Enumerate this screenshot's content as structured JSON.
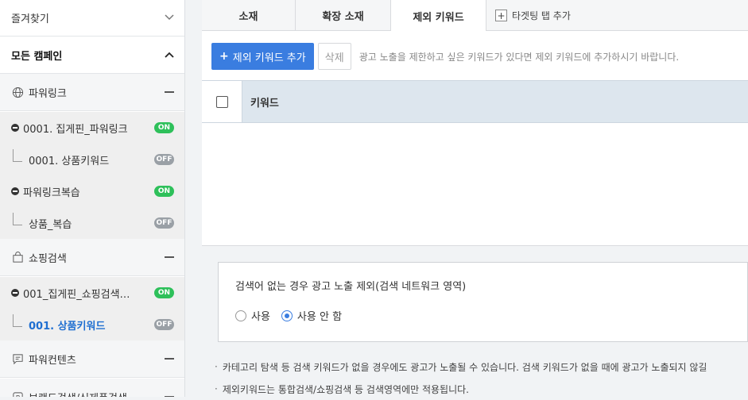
{
  "sidebar": {
    "favorites_label": "즐겨찾기",
    "all_campaigns_label": "모든 캠페인",
    "categories": [
      {
        "label": "파워링크",
        "icon": "globe-icon"
      },
      {
        "label": "쇼핑검색",
        "icon": "shopping-bag-icon"
      },
      {
        "label": "파워컨텐츠",
        "icon": "chat-icon"
      },
      {
        "label": "브랜드검색/신제품검색",
        "icon": "brand-icon"
      }
    ],
    "campaigns": [
      {
        "label": "0001. 집게핀_파워링크",
        "status": "ON"
      },
      {
        "label": "파워링크복습",
        "status": "ON"
      },
      {
        "label": "001_집게핀_쇼핑검색…",
        "status": "ON"
      }
    ],
    "adgroups": [
      {
        "label": "0001. 상품키워드",
        "status": "OFF"
      },
      {
        "label": "상품_복습",
        "status": "OFF"
      },
      {
        "label": "001. 상품키워드",
        "status": "OFF"
      }
    ]
  },
  "tabs": [
    {
      "label": "소재"
    },
    {
      "label": "확장 소재"
    },
    {
      "label": "제외 키워드"
    }
  ],
  "tab_add_label": "타겟팅 탭 추가",
  "toolbar": {
    "add_label": "제외 키워드 추가",
    "delete_label": "삭제",
    "hint": "광고 노출을 제한하고 싶은 키워드가 있다면 제외 키워드에 추가하시기 바랍니다."
  },
  "table": {
    "column_keyword": "키워드"
  },
  "option": {
    "title": "검색어 없는 경우 광고 노출 제외(검색 네트워크 영역)",
    "use_label": "사용",
    "not_use_label": "사용 안 함",
    "selected": "사용 안 함"
  },
  "notes": [
    "카테고리 탐색 등 검색 키워드가 없을 경우에도 광고가 노출될 수 있습니다. 검색 키워드가 없을 때에 광고가 노출되지 않길",
    "제외키워드는 통합검색/쇼핑검색 등 검색영역에만 적용됩니다."
  ],
  "colors": {
    "accent": "#3a7de0",
    "on": "#2ec05a",
    "off": "#9aa0a6",
    "selected_text": "#1f6fd1"
  }
}
